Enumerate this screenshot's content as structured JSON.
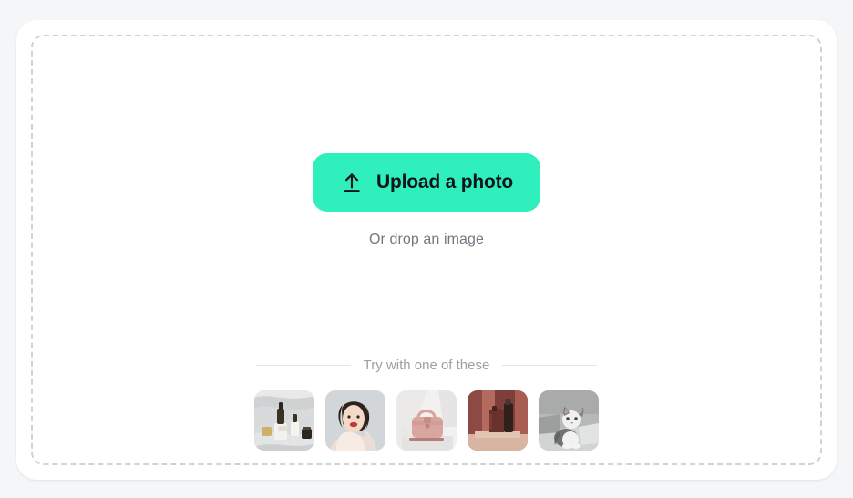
{
  "page": {
    "background_color": "#f5f6f8"
  },
  "card": {
    "background_color": "#ffffff",
    "dropzone_border_color": "#cfd2d6"
  },
  "upload": {
    "button_label": "Upload a photo",
    "button_color": "#2ff0bc",
    "button_text_color": "#111418",
    "icon": "upload-arrow-icon",
    "drop_hint": "Or drop an image"
  },
  "samples": {
    "heading": "Try with one of these",
    "heading_color": "#9aa0a6",
    "rule_color": "#e2e4e7",
    "items": [
      {
        "name": "sample-thumbnail-skincare-bottles",
        "alt": "Serum dropper bottles on white fabric",
        "icon": "photo-thumbnail"
      },
      {
        "name": "sample-thumbnail-woman-portrait",
        "alt": "Portrait of a woman with curly dark hair and red lipstick",
        "icon": "photo-thumbnail"
      },
      {
        "name": "sample-thumbnail-pink-handbag",
        "alt": "Pink leather handbag on a white surface",
        "icon": "photo-thumbnail"
      },
      {
        "name": "sample-thumbnail-cosmetic-tubes",
        "alt": "Dark brown cosmetic tube and bottle on a red backdrop",
        "icon": "photo-thumbnail"
      },
      {
        "name": "sample-thumbnail-grey-cat",
        "alt": "Grey and white cat sitting on grey steps",
        "icon": "photo-thumbnail"
      }
    ]
  }
}
